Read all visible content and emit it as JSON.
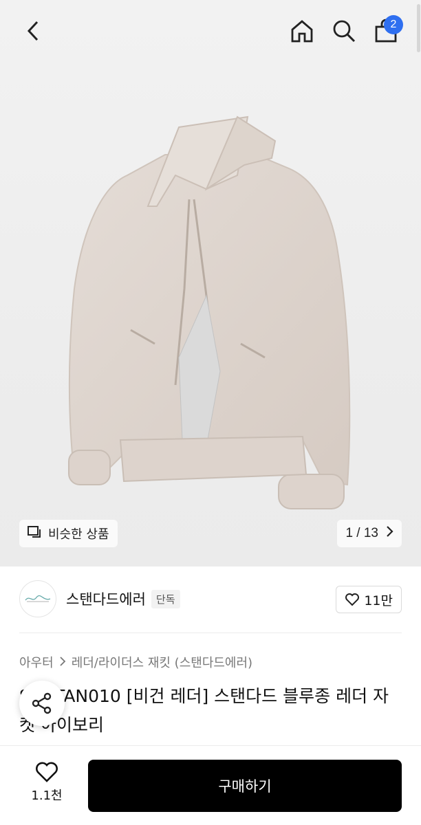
{
  "header": {
    "back_icon": "chevron-left-icon",
    "home_icon": "home-icon",
    "search_icon": "search-icon",
    "cart_icon": "shopping-bag-icon",
    "cart_count": "2",
    "badge_color": "#2f6ff0"
  },
  "gallery": {
    "similar_label": "비슷한 상품",
    "page_indicator": "1 / 13",
    "similar_icon": "similar-products-icon",
    "next_icon": "chevron-right-icon"
  },
  "brand": {
    "name": "스탠다드에러",
    "badge": "단독",
    "like_count": "11만",
    "logo": "brand-logo"
  },
  "breadcrumb": {
    "items": [
      "아우터",
      "레더/라이더스 재킷 (스탠다드에러)"
    ]
  },
  "product": {
    "title": "SDSTAN010 [비건 레더] 스탠다드 블루종 레더 자켓 아이보리"
  },
  "bottom_bar": {
    "wish_count": "1.1천",
    "buy_label": "구매하기"
  },
  "colors": {
    "accent": "#2f6ff0",
    "buy_button": "#000000"
  }
}
